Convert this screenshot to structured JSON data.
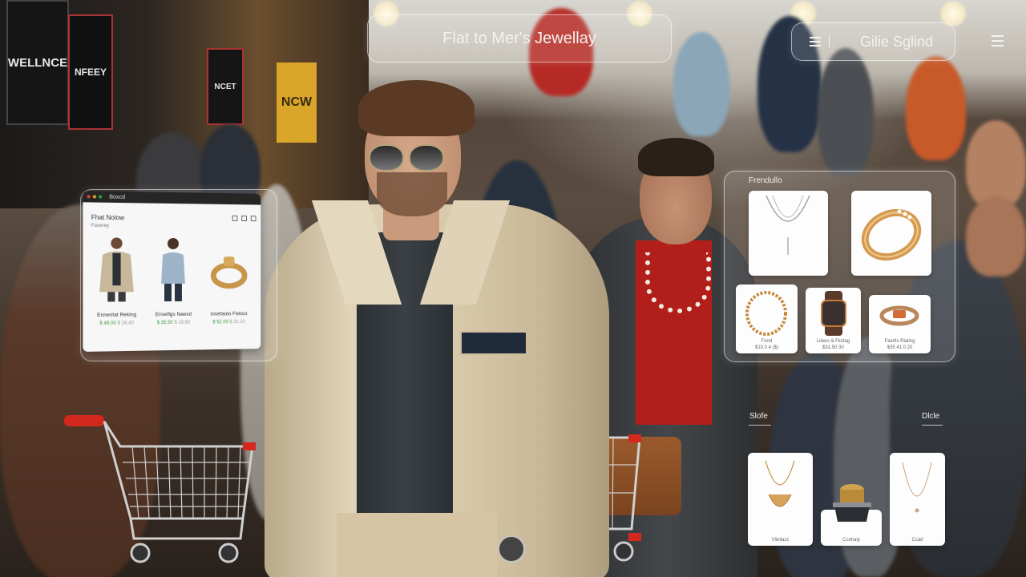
{
  "header": {
    "title": "Flat to Mer's Jewellay",
    "right_label": "Gilie Sglind"
  },
  "store_signs": [
    "WELLNCE",
    "NFEEY",
    "NCET",
    "NCW"
  ],
  "browser": {
    "window_title": "Boxcd",
    "heading": "Fhat Nolow",
    "subheading": "Faverey",
    "products": [
      {
        "name": "Ennentat Reklng",
        "price": "$ 49.00",
        "price2": "$ 28.40"
      },
      {
        "name": "Enseflgs Naexd",
        "price": "$ 35.50",
        "price2": "$ 19.90"
      },
      {
        "name": "Iosefaolo Fekico",
        "price": "$ 52.00",
        "price2": "$ 31.10"
      }
    ]
  },
  "jewelry_panel": {
    "label": "Frendullo",
    "items": [
      {
        "name": "",
        "caption": ""
      },
      {
        "name": "",
        "caption": ""
      },
      {
        "name": "Fsnd",
        "caption": "$10.0 4 ($)"
      },
      {
        "name": "Lileeo & Fkstag",
        "caption": "$31.50 30"
      },
      {
        "name": "Faerlls Rlaling",
        "caption": "$35 41 0 20"
      }
    ]
  },
  "bottom_section": {
    "left_label": "Slofe",
    "right_label": "Dlcle",
    "items": [
      {
        "name": "Vlieliazc"
      },
      {
        "name": "Ccehaly"
      },
      {
        "name": "Ccad"
      }
    ]
  }
}
